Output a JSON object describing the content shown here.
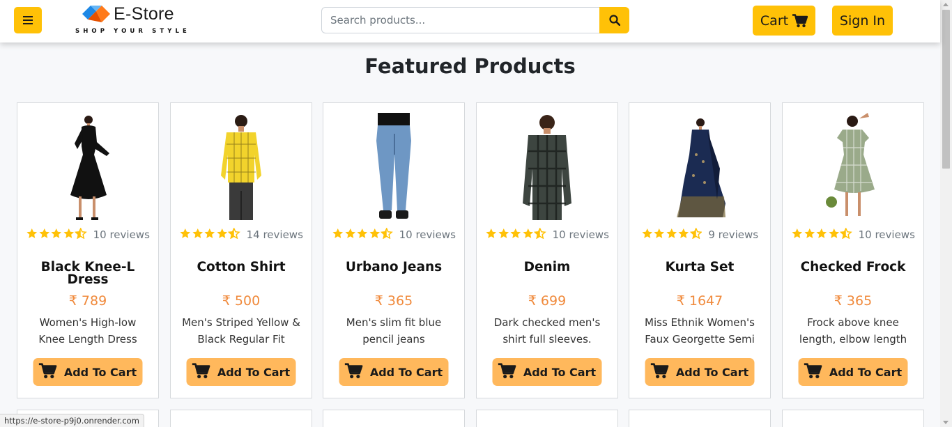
{
  "navbar": {
    "menu_icon": "hamburger-icon",
    "logo_title": "E-Store",
    "logo_tagline": "SHOP YOUR STYLE",
    "search_placeholder": "Search products...",
    "search_icon": "search-icon",
    "cart_label": "Cart",
    "cart_icon": "cart-icon",
    "signin_label": "Sign In"
  },
  "page_title": "Featured Products",
  "products": [
    {
      "name": "Black Knee-L Dress",
      "rating": 4.5,
      "reviews": "10 reviews",
      "price": "₹ 789",
      "description": "Women's High-low Knee Length Dress",
      "button_label": "Add To Cart",
      "image": "black-dress-photo"
    },
    {
      "name": "Cotton Shirt",
      "rating": 4.5,
      "reviews": "14 reviews",
      "price": "₹ 500",
      "description": "Men's Striped Yellow & Black Regular Fit Cotton",
      "button_label": "Add To Cart",
      "image": "yellow-shirt-photo"
    },
    {
      "name": "Urbano Jeans",
      "rating": 4.5,
      "reviews": "10 reviews",
      "price": "₹ 365",
      "description": "Men's slim fit blue pencil jeans",
      "button_label": "Add To Cart",
      "image": "blue-jeans-photo"
    },
    {
      "name": "Denim",
      "rating": 4.5,
      "reviews": "10 reviews",
      "price": "₹ 699",
      "description": "Dark checked men's shirt full sleeves.",
      "button_label": "Add To Cart",
      "image": "checked-shirt-photo"
    },
    {
      "name": "Kurta Set",
      "rating": 4.5,
      "reviews": "9 reviews",
      "price": "₹ 1647",
      "description": "Miss Ethnik Women's Faux Georgette Semi",
      "button_label": "Add To Cart",
      "image": "kurta-set-photo"
    },
    {
      "name": "Checked Frock",
      "rating": 4.5,
      "reviews": "10 reviews",
      "price": "₹ 365",
      "description": "Frock above knee length, elbow length",
      "button_label": "Add To Cart",
      "image": "checked-frock-photo"
    }
  ],
  "status_bar_url": "https://e-store-p9j0.onrender.com",
  "colors": {
    "accent": "#ffc107",
    "button": "#ffb85c",
    "price": "#f08a3c",
    "star": "#ffc107"
  }
}
